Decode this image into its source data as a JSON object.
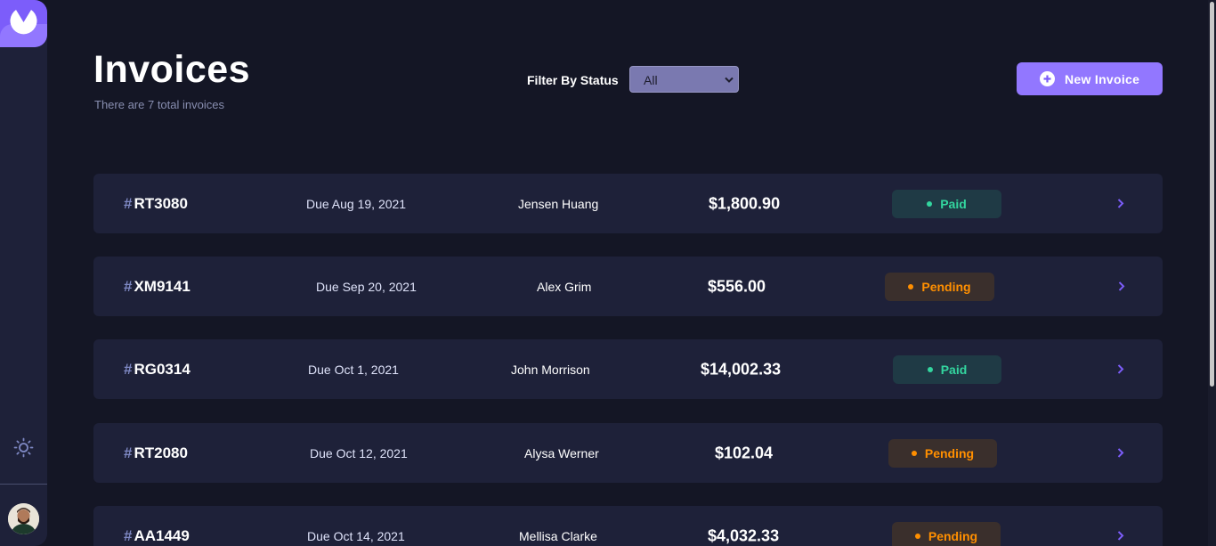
{
  "header": {
    "title": "Invoices",
    "subtitle": "There are 7 total invoices",
    "filter_label": "Filter By Status",
    "filter_value": "All",
    "new_invoice_label": "New Invoice"
  },
  "sidebar": {
    "logo_icon": "logo-icon",
    "theme_icon": "sun-icon",
    "avatar": "user-avatar"
  },
  "colors": {
    "background": "#141625",
    "card": "#1e2139",
    "accent": "#9277ff",
    "paid": "#33d69f",
    "pending": "#ff8f00"
  },
  "invoices": [
    {
      "id": "RT3080",
      "due": "Due Aug 19, 2021",
      "client": "Jensen Huang",
      "amount": "$1,800.90",
      "status": "Paid"
    },
    {
      "id": "XM9141",
      "due": "Due Sep 20, 2021",
      "client": "Alex Grim",
      "amount": "$556.00",
      "status": "Pending"
    },
    {
      "id": "RG0314",
      "due": "Due Oct 1, 2021",
      "client": "John Morrison",
      "amount": "$14,002.33",
      "status": "Paid"
    },
    {
      "id": "RT2080",
      "due": "Due Oct 12, 2021",
      "client": "Alysa Werner",
      "amount": "$102.04",
      "status": "Pending"
    },
    {
      "id": "AA1449",
      "due": "Due Oct 14, 2021",
      "client": "Mellisa Clarke",
      "amount": "$4,032.33",
      "status": "Pending"
    }
  ],
  "hash_symbol": "#"
}
